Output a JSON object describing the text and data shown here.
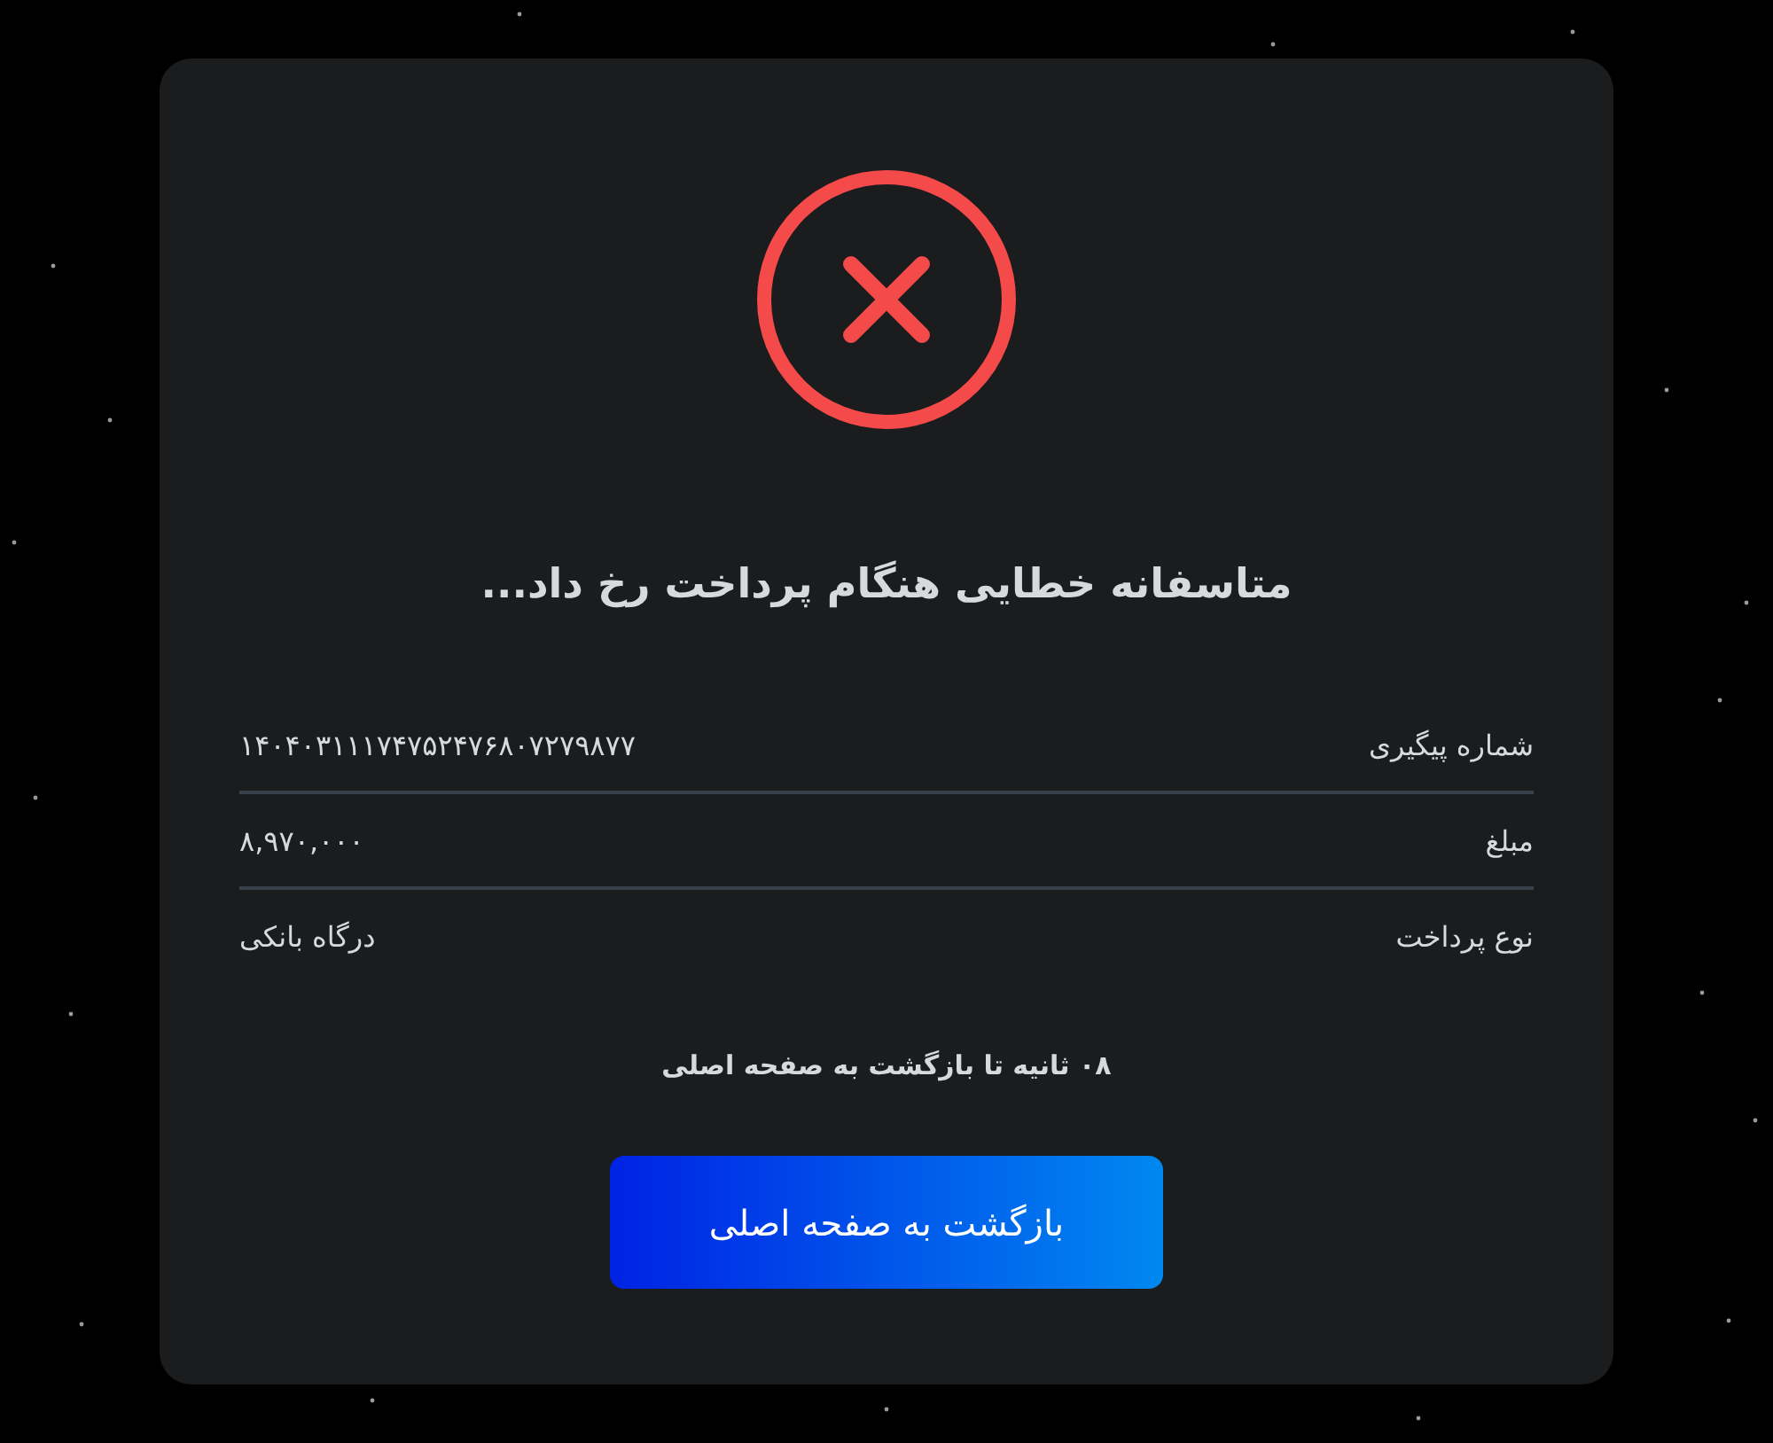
{
  "status": {
    "kind": "error",
    "title": "متاسفانه خطایی هنگام پرداخت رخ داد..."
  },
  "details": [
    {
      "label": "شماره پیگیری",
      "value": "۱۴۰۴۰۳۱۱۱۷۴۷۵۲۴۷۶۸۰۷۲۷۹۸۷۷"
    },
    {
      "label": "مبلغ",
      "value": "۸,۹۷۰,۰۰۰"
    },
    {
      "label": "نوع پرداخت",
      "value": "درگاه بانکی"
    }
  ],
  "countdown": "۰۸ ثانیه تا بازگشت به صفحه اصلی",
  "button": "بازگشت به صفحه اصلی"
}
